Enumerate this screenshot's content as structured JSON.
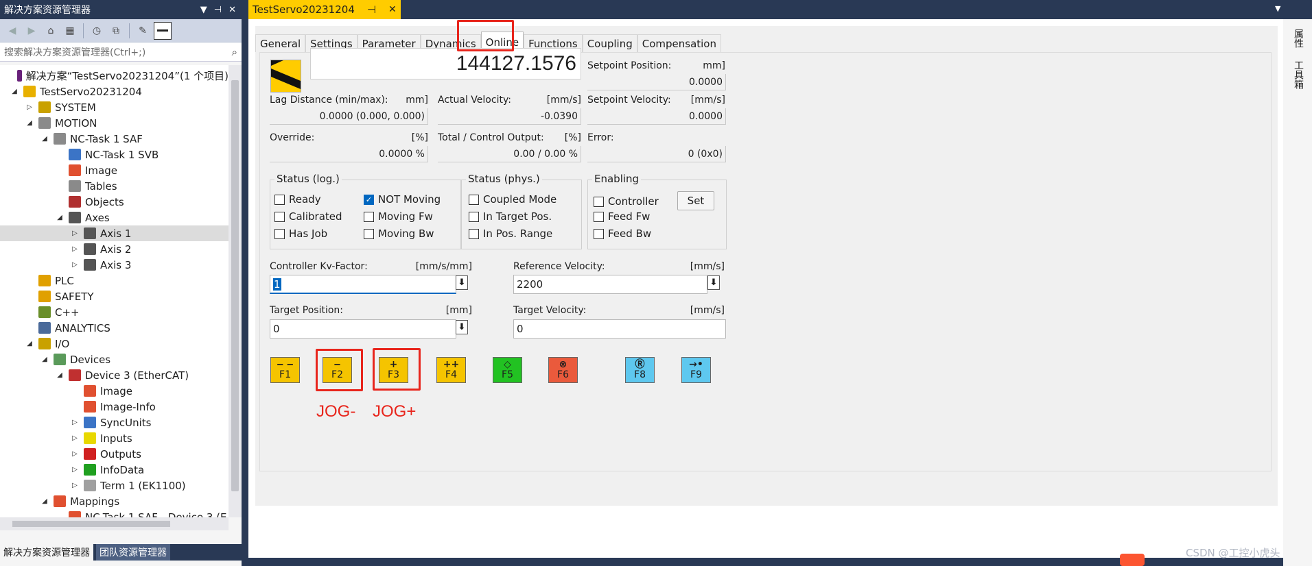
{
  "solution_explorer": {
    "title": "解决方案资源管理器",
    "search_placeholder": "搜索解决方案资源管理器(Ctrl+;)",
    "tree": [
      {
        "label": "解决方案“TestServo20231204”(1 个项目)",
        "level": 0,
        "expander": "",
        "icon": "solution-icon",
        "color": "#68217a"
      },
      {
        "label": "TestServo20231204",
        "level": 0,
        "expander": "◢",
        "icon": "project-icon",
        "color": "#e8b000"
      },
      {
        "label": "SYSTEM",
        "level": 1,
        "expander": "▷",
        "icon": "system-icon",
        "color": "#c9a100"
      },
      {
        "label": "MOTION",
        "level": 1,
        "expander": "◢",
        "icon": "motion-icon",
        "color": "#8a8a8a"
      },
      {
        "label": "NC-Task 1 SAF",
        "level": 2,
        "expander": "◢",
        "icon": "nc-task-icon",
        "color": "#8a8a8a"
      },
      {
        "label": "NC-Task 1 SVB",
        "level": 3,
        "expander": "",
        "icon": "svb-icon",
        "color": "#3b74c6"
      },
      {
        "label": "Image",
        "level": 3,
        "expander": "",
        "icon": "image-icon",
        "color": "#e05030"
      },
      {
        "label": "Tables",
        "level": 3,
        "expander": "",
        "icon": "tables-icon",
        "color": "#8a8a8a"
      },
      {
        "label": "Objects",
        "level": 3,
        "expander": "",
        "icon": "objects-icon",
        "color": "#b03030"
      },
      {
        "label": "Axes",
        "level": 3,
        "expander": "◢",
        "icon": "axes-icon",
        "color": "#555555"
      },
      {
        "label": "Axis 1",
        "level": 4,
        "expander": "▷",
        "icon": "axis-icon",
        "color": "#555555",
        "selected": true
      },
      {
        "label": "Axis 2",
        "level": 4,
        "expander": "▷",
        "icon": "axis-icon",
        "color": "#555555"
      },
      {
        "label": "Axis 3",
        "level": 4,
        "expander": "▷",
        "icon": "axis-icon",
        "color": "#555555"
      },
      {
        "label": "PLC",
        "level": 1,
        "expander": "",
        "icon": "plc-icon",
        "color": "#e0a000"
      },
      {
        "label": "SAFETY",
        "level": 1,
        "expander": "",
        "icon": "safety-icon",
        "color": "#e0a000"
      },
      {
        "label": "C++",
        "level": 1,
        "expander": "",
        "icon": "cpp-icon",
        "color": "#6a8f2a"
      },
      {
        "label": "ANALYTICS",
        "level": 1,
        "expander": "",
        "icon": "analytics-icon",
        "color": "#4a6a9a"
      },
      {
        "label": "I/O",
        "level": 1,
        "expander": "◢",
        "icon": "io-icon",
        "color": "#c9a100"
      },
      {
        "label": "Devices",
        "level": 2,
        "expander": "◢",
        "icon": "devices-icon",
        "color": "#5a9a5a"
      },
      {
        "label": "Device 3 (EtherCAT)",
        "level": 3,
        "expander": "◢",
        "icon": "ethercat-icon",
        "color": "#c03030"
      },
      {
        "label": "Image",
        "level": 4,
        "expander": "",
        "icon": "image-icon",
        "color": "#e05030"
      },
      {
        "label": "Image-Info",
        "level": 4,
        "expander": "",
        "icon": "image-info-icon",
        "color": "#e05030"
      },
      {
        "label": "SyncUnits",
        "level": 4,
        "expander": "▷",
        "icon": "syncunits-icon",
        "color": "#3b74c6"
      },
      {
        "label": "Inputs",
        "level": 4,
        "expander": "▷",
        "icon": "inputs-icon",
        "color": "#e8d800"
      },
      {
        "label": "Outputs",
        "level": 4,
        "expander": "▷",
        "icon": "outputs-icon",
        "color": "#d02020"
      },
      {
        "label": "InfoData",
        "level": 4,
        "expander": "▷",
        "icon": "infodata-icon",
        "color": "#20a020"
      },
      {
        "label": "Term 1 (EK1100)",
        "level": 4,
        "expander": "▷",
        "icon": "terminal-icon",
        "color": "#a0a0a0"
      },
      {
        "label": "Mappings",
        "level": 2,
        "expander": "◢",
        "icon": "mappings-icon",
        "color": "#e05030"
      },
      {
        "label": "NC-Task 1 SAF - Device 3 (E",
        "level": 3,
        "expander": "",
        "icon": "mapping-icon",
        "color": "#e05030"
      }
    ],
    "bottom_tabs": [
      "解决方案资源管理器",
      "团队资源管理器"
    ]
  },
  "document": {
    "tab_title": "TestServo20231204",
    "pin_glyph": "⊣",
    "close_glyph": "✕"
  },
  "right_strip": {
    "items": [
      "属性",
      "工具箱"
    ]
  },
  "tabs": [
    "General",
    "Settings",
    "Parameter",
    "Dynamics",
    "Online",
    "Functions",
    "Coupling",
    "Compensation"
  ],
  "active_tab": "Online",
  "online": {
    "actual_position": "144127.1576",
    "setpoint_position": {
      "label": "Setpoint Position:",
      "unit": "mm]",
      "value": "0.0000"
    },
    "lag_distance": {
      "label": "Lag Distance (min/max):",
      "unit": "mm]",
      "value": "0.0000  (0.000, 0.000)"
    },
    "actual_velocity": {
      "label": "Actual Velocity:",
      "unit": "[mm/s]",
      "value": "-0.0390"
    },
    "setpoint_velocity": {
      "label": "Setpoint Velocity:",
      "unit": "[mm/s]",
      "value": "0.0000"
    },
    "override": {
      "label": "Override:",
      "unit": "[%]",
      "value": "0.0000 %"
    },
    "total_output": {
      "label": "Total / Control Output:",
      "unit": "[%]",
      "value": "0.00 /  0.00 %"
    },
    "error": {
      "label": "Error:",
      "value": "0 (0x0)"
    },
    "status_log": {
      "title": "Status (log.)",
      "items": [
        {
          "label": "Ready",
          "checked": false
        },
        {
          "label": "NOT Moving",
          "checked": true
        },
        {
          "label": "Calibrated",
          "checked": false
        },
        {
          "label": "Moving Fw",
          "checked": false
        },
        {
          "label": "Has Job",
          "checked": false
        },
        {
          "label": "Moving Bw",
          "checked": false
        }
      ]
    },
    "status_phys": {
      "title": "Status (phys.)",
      "items": [
        {
          "label": "Coupled Mode",
          "checked": false
        },
        {
          "label": "In Target Pos.",
          "checked": false
        },
        {
          "label": "In Pos. Range",
          "checked": false
        }
      ]
    },
    "enabling": {
      "title": "Enabling",
      "items": [
        {
          "label": "Controller",
          "checked": false
        },
        {
          "label": "Feed Fw",
          "checked": false
        },
        {
          "label": "Feed Bw",
          "checked": false
        }
      ],
      "set_label": "Set"
    },
    "kv_factor": {
      "label": "Controller Kv-Factor:",
      "unit": "[mm/s/mm]",
      "value": "1"
    },
    "reference_velocity": {
      "label": "Reference Velocity:",
      "unit": "[mm/s]",
      "value": "2200"
    },
    "target_position": {
      "label": "Target Position:",
      "unit": "[mm]",
      "value": "0"
    },
    "target_velocity": {
      "label": "Target Velocity:",
      "unit": "[mm/s]",
      "value": "0"
    },
    "download_glyph": "⬇",
    "function_keys": [
      {
        "key": "F1",
        "symbol": "‒ ‒",
        "color": "#f5c400"
      },
      {
        "key": "F2",
        "symbol": "‒",
        "color": "#f5c400"
      },
      {
        "key": "F3",
        "symbol": "+",
        "color": "#f5c400"
      },
      {
        "key": "F4",
        "symbol": "++",
        "color": "#f5c400"
      },
      {
        "key": "F5",
        "symbol": "◇",
        "color": "#22c222"
      },
      {
        "key": "F6",
        "symbol": "⊗",
        "color": "#ea5a3c"
      },
      {
        "key": "F8",
        "symbol": "Ⓡ",
        "color": "#5ec8ef"
      },
      {
        "key": "F9",
        "symbol": "→•",
        "color": "#5ec8ef"
      }
    ],
    "annotations": {
      "jog_minus": "JOG-",
      "jog_plus": "JOG+",
      "color": "#e8251c"
    }
  },
  "watermark": "CSDN @工控小虎头"
}
